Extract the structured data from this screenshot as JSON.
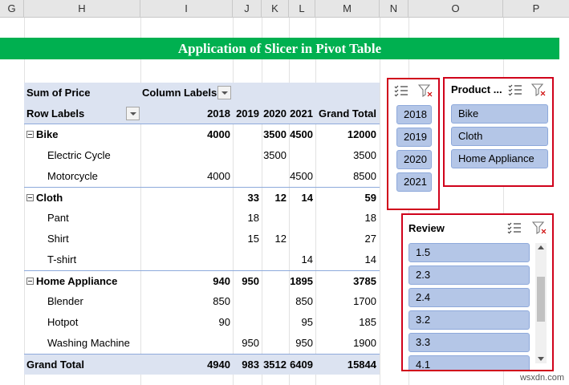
{
  "columns": [
    "G",
    "H",
    "I",
    "J",
    "K",
    "L",
    "M",
    "N",
    "O",
    "P"
  ],
  "banner": {
    "title": "Application of Slicer in Pivot Table"
  },
  "pivot": {
    "value_label": "Sum of Price",
    "column_labels": "Column Labels",
    "row_labels": "Row Labels",
    "headers": [
      "2018",
      "2019",
      "2020",
      "2021",
      "Grand Total"
    ],
    "rows": [
      {
        "label": "Bike",
        "level": 0,
        "values": [
          "4000",
          "",
          "3500",
          "4500",
          "12000"
        ]
      },
      {
        "label": "Electric Cycle",
        "level": 1,
        "values": [
          "",
          "",
          "3500",
          "",
          "3500"
        ]
      },
      {
        "label": "Motorcycle",
        "level": 1,
        "values": [
          "4000",
          "",
          "",
          "4500",
          "8500"
        ]
      },
      {
        "label": "Cloth",
        "level": 0,
        "values": [
          "",
          "33",
          "12",
          "14",
          "59"
        ]
      },
      {
        "label": "Pant",
        "level": 1,
        "values": [
          "",
          "18",
          "",
          "",
          "18"
        ]
      },
      {
        "label": "Shirt",
        "level": 1,
        "values": [
          "",
          "15",
          "12",
          "",
          "27"
        ]
      },
      {
        "label": "T-shirt",
        "level": 1,
        "values": [
          "",
          "",
          "",
          "14",
          "14"
        ]
      },
      {
        "label": "Home Appliance",
        "level": 0,
        "values": [
          "940",
          "950",
          "",
          "1895",
          "3785"
        ]
      },
      {
        "label": "Blender",
        "level": 1,
        "values": [
          "850",
          "",
          "",
          "850",
          "1700"
        ]
      },
      {
        "label": "Hotpot",
        "level": 1,
        "values": [
          "90",
          "",
          "",
          "95",
          "185"
        ]
      },
      {
        "label": "Washing Machine",
        "level": 1,
        "values": [
          "",
          "950",
          "",
          "950",
          "1900"
        ]
      }
    ],
    "grand_total": {
      "label": "Grand Total",
      "values": [
        "4940",
        "983",
        "3512",
        "6409",
        "15844"
      ]
    }
  },
  "slicers": {
    "year": {
      "items": [
        "2018",
        "2019",
        "2020",
        "2021"
      ]
    },
    "product": {
      "title": "Product ...",
      "items": [
        "Bike",
        "Cloth",
        "Home Appliance"
      ]
    },
    "review": {
      "title": "Review",
      "items": [
        "1.5",
        "2.3",
        "2.4",
        "3.2",
        "3.3",
        "4.1"
      ]
    }
  },
  "watermark": "wsxdn.com",
  "colors": {
    "banner": "#00b050",
    "slicer_border": "#d0021b",
    "slicer_item": "#b4c6e7",
    "pivot_header": "#dce3f1"
  }
}
